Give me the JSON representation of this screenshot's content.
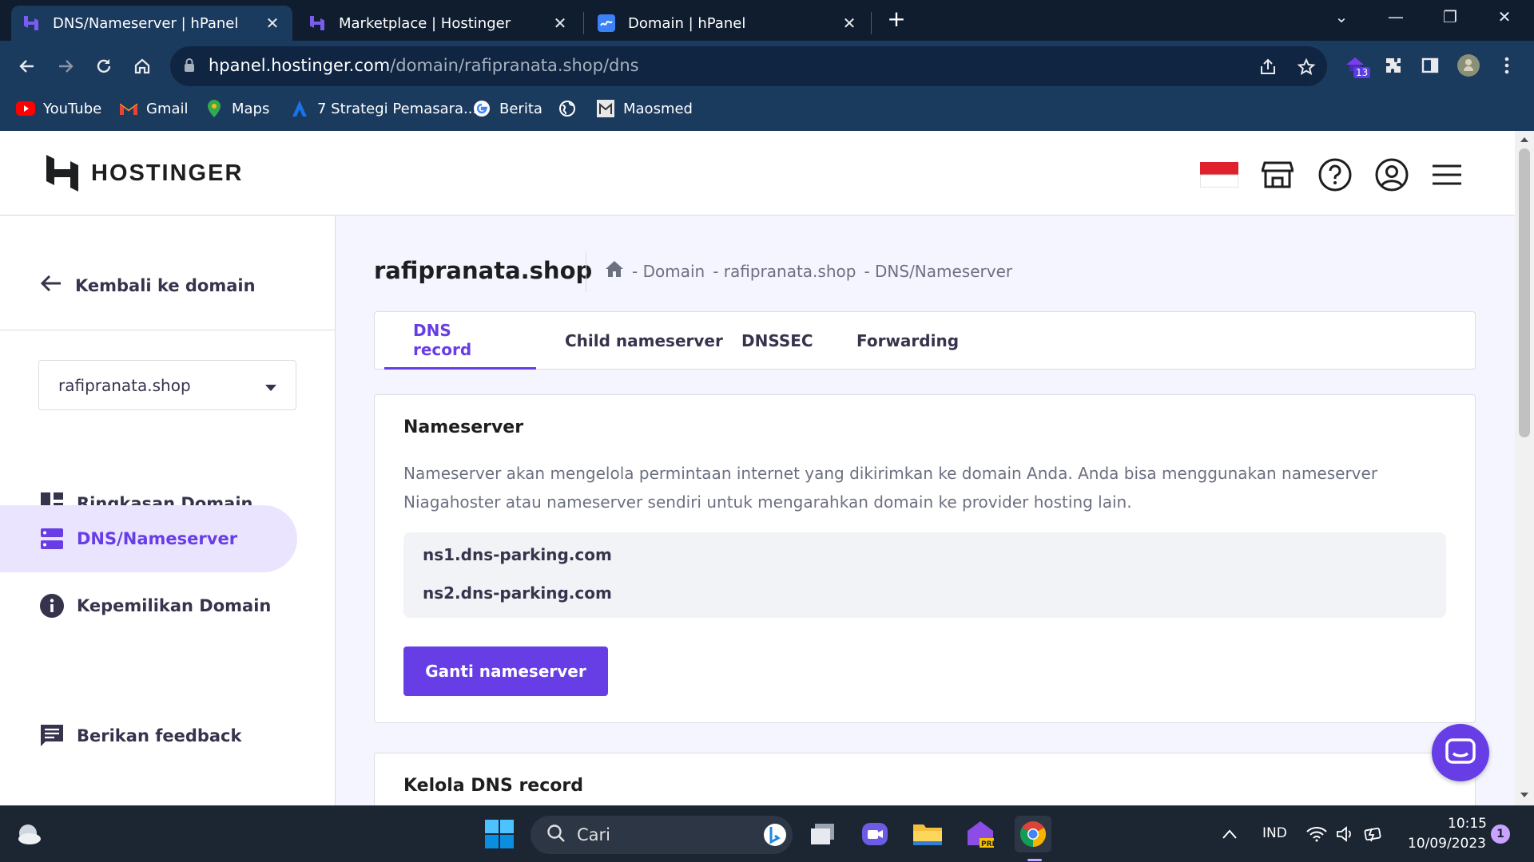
{
  "browser": {
    "tabs": [
      {
        "title": "DNS/Nameserver | hPanel",
        "active": true,
        "icon": "hostinger-favicon"
      },
      {
        "title": "Marketplace | Hostinger",
        "active": false,
        "icon": "hostinger-favicon"
      },
      {
        "title": "Domain | hPanel",
        "active": false,
        "icon": "domain-favicon"
      }
    ],
    "url_host": "hpanel.hostinger.com",
    "url_path": "/domain/rafipranata.shop/dns",
    "extension_badge": "13",
    "bookmarks": [
      {
        "label": "YouTube",
        "icon": "youtube-icon"
      },
      {
        "label": "Gmail",
        "icon": "gmail-icon"
      },
      {
        "label": "Maps",
        "icon": "maps-icon"
      },
      {
        "label": "7 Strategi Pemasara...",
        "icon": "a-icon"
      },
      {
        "label": "Berita",
        "icon": "google-icon"
      },
      {
        "label": "",
        "icon": "globe-icon"
      },
      {
        "label": "Maosmed",
        "icon": "maosmed-icon"
      }
    ]
  },
  "header": {
    "logo_text": "HOSTINGER"
  },
  "sidebar": {
    "back_label": "Kembali ke domain",
    "domain_selected": "rafipranata.shop",
    "items": [
      {
        "label": "Ringkasan Domain",
        "icon": "dashboard-icon",
        "active": false
      },
      {
        "label": "DNS/Nameserver",
        "icon": "dns-icon",
        "active": true
      },
      {
        "label": "Kepemilikan Domain",
        "icon": "info-icon",
        "active": false
      }
    ],
    "feedback_label": "Berikan feedback"
  },
  "main": {
    "title": "rafipranata.shop",
    "breadcrumb": [
      "- Domain",
      "- rafipranata.shop",
      "- DNS/Nameserver"
    ],
    "tabs": [
      {
        "label": "DNS record",
        "active": true
      },
      {
        "label": "Child nameserver",
        "active": false
      },
      {
        "label": "DNSSEC",
        "active": false
      },
      {
        "label": "Forwarding",
        "active": false
      }
    ],
    "nameserver_card": {
      "title": "Nameserver",
      "description": "Nameserver akan mengelola permintaan internet yang dikirimkan ke domain Anda. Anda bisa menggunakan nameserver Niagahoster atau nameserver sendiri untuk mengarahkan domain ke provider hosting lain.",
      "nameservers": [
        "ns1.dns-parking.com",
        "ns2.dns-parking.com"
      ],
      "button_label": "Ganti nameserver"
    },
    "dns_card": {
      "title": "Kelola DNS record"
    }
  },
  "taskbar": {
    "search_placeholder": "Cari",
    "language": "IND",
    "time": "10:15",
    "date": "10/09/2023",
    "notification_count": "1"
  },
  "colors": {
    "brand_purple": "#673de6",
    "active_bg": "#ebe4ff",
    "chrome_dark": "#0f1d2f",
    "chrome_toolbar": "#1a3a5e"
  }
}
